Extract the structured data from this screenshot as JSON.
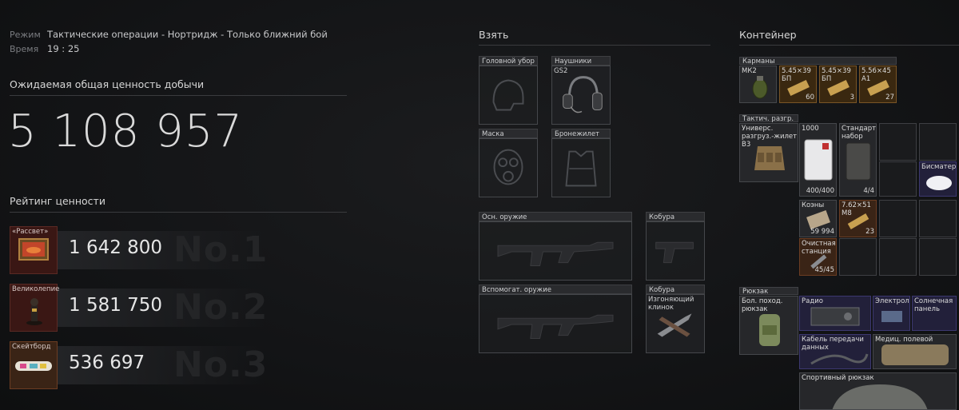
{
  "mode": {
    "label": "Режим",
    "value": "Тактические операции - Нортридж - Только ближний бой"
  },
  "time": {
    "label": "Время",
    "value": "19 : 25"
  },
  "loot": {
    "title": "Ожидаемая общая ценность добычи",
    "total": "5 108 957"
  },
  "rating": {
    "title": "Рейтинг ценности",
    "items": [
      {
        "name": "«Рассвет»",
        "value": "1 642 800",
        "rank": "No.1",
        "icon": "painting-icon"
      },
      {
        "name": "Великолепие",
        "value": "1 581 750",
        "rank": "No.2",
        "icon": "statuette-icon"
      },
      {
        "name": "Скейтборд",
        "value": "536 697",
        "rank": "No.3",
        "icon": "hoverboard-icon"
      }
    ]
  },
  "take": {
    "title": "Взять",
    "slots": {
      "head": {
        "title": "Головной убор",
        "item": ""
      },
      "headphones": {
        "title": "Наушники",
        "item": "GS2"
      },
      "mask": {
        "title": "Маска",
        "item": ""
      },
      "armor": {
        "title": "Бронежилет",
        "item": ""
      },
      "primary": {
        "title": "Осн. оружие",
        "item": ""
      },
      "holster1": {
        "title": "Кобура",
        "item": ""
      },
      "secondary": {
        "title": "Вспомогат. оружие",
        "item": ""
      },
      "holster2": {
        "title": "Кобура",
        "item": "Изгоняющий клинок"
      }
    }
  },
  "container": {
    "title": "Контейнер",
    "pockets": {
      "title": "Карманы",
      "items": [
        {
          "name": "МК2",
          "count": "",
          "icon": "grenade-icon",
          "tier": "grey"
        },
        {
          "name": "5.45×39 БП",
          "count": "60",
          "icon": "ammo-icon",
          "tier": "gold"
        },
        {
          "name": "5.45×39 БП",
          "count": "3",
          "icon": "ammo-icon",
          "tier": "gold"
        },
        {
          "name": "5.56×45 A1",
          "count": "27",
          "icon": "ammo-icon",
          "tier": "gold"
        }
      ]
    },
    "rig": {
      "title": "Тактич. разгр.",
      "name": "Универс. разгруз.-жилет B3",
      "items": [
        {
          "name": "1000",
          "count": "400/400",
          "icon": "bandage-icon"
        },
        {
          "name": "Стандартный набор",
          "count": "4/4",
          "icon": "kit-icon"
        },
        {
          "name": "Бисматер",
          "count": "",
          "icon": "pill-icon"
        },
        {
          "name": "Коэны",
          "count": "59 994",
          "icon": "cash-icon"
        },
        {
          "name": "7.62×51 M8",
          "count": "23",
          "icon": "ammo-icon"
        },
        {
          "name": "Очистная станция",
          "count": "45/45",
          "icon": "cleaning-kit-icon"
        }
      ]
    },
    "backpack": {
      "title": "Рюкзак",
      "name": "Бол. поход. рюкзак",
      "items": [
        {
          "name": "Радио",
          "icon": "radio-icon"
        },
        {
          "name": "Электрол",
          "icon": "electrolyte-icon"
        },
        {
          "name": "Солнечная панель",
          "icon": "solar-panel-icon"
        },
        {
          "name": "Кабель передачи данных",
          "icon": "cable-icon"
        },
        {
          "name": "Медиц. полевой",
          "icon": "medkit-icon"
        },
        {
          "name": "Спортивный рюкзак",
          "icon": "backpack-icon"
        }
      ]
    }
  }
}
